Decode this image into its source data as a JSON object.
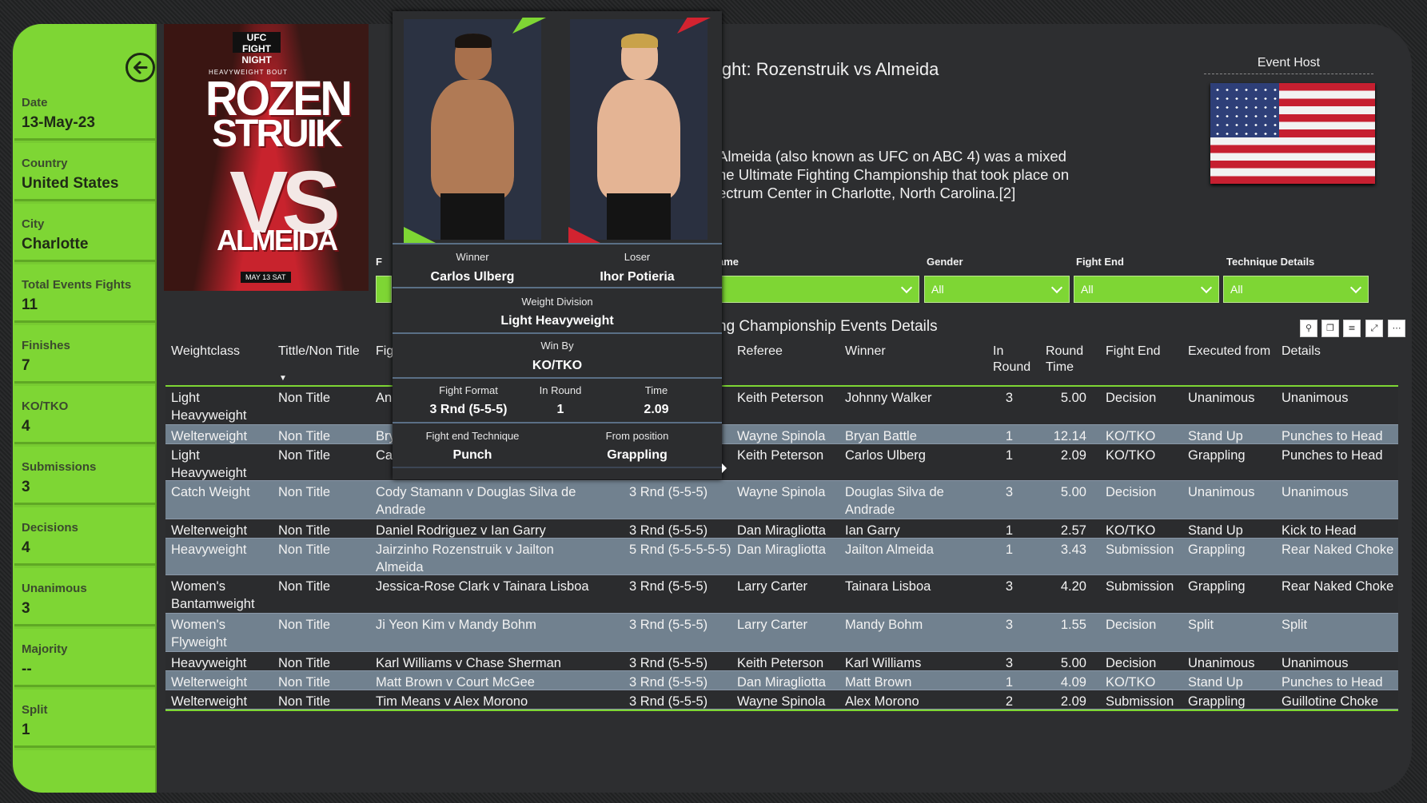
{
  "sidebar": {
    "kpis": [
      {
        "label": "Date",
        "value": "13-May-23"
      },
      {
        "label": "Country",
        "value": "United States"
      },
      {
        "label": "City",
        "value": "Charlotte"
      },
      {
        "label": "Total Events Fights",
        "value": "11"
      },
      {
        "label": "Finishes",
        "value": "7"
      },
      {
        "label": "KO/TKO",
        "value": "4"
      },
      {
        "label": "Submissions",
        "value": "3"
      },
      {
        "label": "Decisions",
        "value": "4"
      },
      {
        "label": "Unanimous",
        "value": "3"
      },
      {
        "label": "Majority",
        "value": "--"
      },
      {
        "label": "Split",
        "value": "1"
      }
    ]
  },
  "poster": {
    "logo": "UFC FIGHT NIGHT",
    "bout": "HEAVYWEIGHT BOUT",
    "name1a": "ROZEN",
    "name1b": "STRUIK",
    "vs": "VS",
    "name2": "ALMEIDA",
    "date": "MAY 13 SAT"
  },
  "header": {
    "title": "ight: Rozenstruik vs Almeida",
    "description": "Almeida (also known as UFC on ABC 4) was a mixed\nhe Ultimate Fighting Championship that took place on\nectrum Center in Charlotte, North Carolina.[2]",
    "host_label": "Event Host"
  },
  "slicers": [
    {
      "label": "F",
      "value": ""
    },
    {
      "label": "ame",
      "value": ""
    },
    {
      "label": "Gender",
      "value": "All"
    },
    {
      "label": "Fight End",
      "value": "All"
    },
    {
      "label": "Technique Details",
      "value": "All"
    }
  ],
  "table": {
    "title": "ng Championship Events Details",
    "columns": [
      "Weightclass",
      "Tittle/Non Title",
      "Fig",
      "",
      "Referee",
      "Winner",
      "In Round",
      "Round Time",
      "Fight End",
      "Executed from",
      "Details"
    ],
    "rows": [
      {
        "wc": "Light\nHeavyweight",
        "tt": "Non Title",
        "fight": "An",
        "fmt": "",
        "ref": "Keith Peterson",
        "win": "Johnny Walker",
        "rnd": "3",
        "time": "5.00",
        "end": "Decision",
        "from": "Unanimous",
        "det": "Unanimous"
      },
      {
        "wc": "Welterweight",
        "tt": "Non Title",
        "fight": "Bry",
        "fmt": "",
        "ref": "Wayne Spinola",
        "win": "Bryan Battle",
        "rnd": "1",
        "time": "12.14",
        "end": "KO/TKO",
        "from": "Stand Up",
        "det": "Punches to Head"
      },
      {
        "wc": "Light\nHeavyweight",
        "tt": "Non Title",
        "fight": "Ca",
        "fmt": "",
        "ref": "Keith Peterson",
        "win": "Carlos Ulberg",
        "rnd": "1",
        "time": "2.09",
        "end": "KO/TKO",
        "from": "Grappling",
        "det": "Punches to Head"
      },
      {
        "wc": "Catch Weight",
        "tt": "Non Title",
        "fight": "Cody Stamann v Douglas Silva de\nAndrade",
        "fmt": "3 Rnd (5-5-5)",
        "ref": "Wayne Spinola",
        "win": "Douglas Silva de\nAndrade",
        "rnd": "3",
        "time": "5.00",
        "end": "Decision",
        "from": "Unanimous",
        "det": "Unanimous"
      },
      {
        "wc": "Welterweight",
        "tt": "Non Title",
        "fight": "Daniel Rodriguez v Ian Garry",
        "fmt": "3 Rnd (5-5-5)",
        "ref": "Dan Miragliotta",
        "win": "Ian Garry",
        "rnd": "1",
        "time": "2.57",
        "end": "KO/TKO",
        "from": "Stand Up",
        "det": "Kick to Head"
      },
      {
        "wc": "Heavyweight",
        "tt": "Non Title",
        "fight": "Jairzinho Rozenstruik v Jailton\nAlmeida",
        "fmt": "5 Rnd (5-5-5-5-5)",
        "ref": "Dan Miragliotta",
        "win": "Jailton Almeida",
        "rnd": "1",
        "time": "3.43",
        "end": "Submission",
        "from": "Grappling",
        "det": "Rear Naked Choke"
      },
      {
        "wc": "Women's\nBantamweight",
        "tt": "Non Title",
        "fight": "Jessica-Rose Clark v Tainara Lisboa",
        "fmt": "3 Rnd (5-5-5)",
        "ref": "Larry Carter",
        "win": "Tainara Lisboa",
        "rnd": "3",
        "time": "4.20",
        "end": "Submission",
        "from": "Grappling",
        "det": "Rear Naked Choke"
      },
      {
        "wc": "Women's\nFlyweight",
        "tt": "Non Title",
        "fight": "Ji Yeon Kim v Mandy Bohm",
        "fmt": "3 Rnd (5-5-5)",
        "ref": "Larry Carter",
        "win": "Mandy Bohm",
        "rnd": "3",
        "time": "1.55",
        "end": "Decision",
        "from": "Split",
        "det": "Split"
      },
      {
        "wc": "Heavyweight",
        "tt": "Non Title",
        "fight": "Karl Williams v Chase Sherman",
        "fmt": "3 Rnd (5-5-5)",
        "ref": "Keith Peterson",
        "win": "Karl Williams",
        "rnd": "3",
        "time": "5.00",
        "end": "Decision",
        "from": "Unanimous",
        "det": "Unanimous"
      },
      {
        "wc": "Welterweight",
        "tt": "Non Title",
        "fight": "Matt Brown v Court McGee",
        "fmt": "3 Rnd (5-5-5)",
        "ref": "Dan Miragliotta",
        "win": "Matt Brown",
        "rnd": "1",
        "time": "4.09",
        "end": "KO/TKO",
        "from": "Stand Up",
        "det": "Punches to Head"
      },
      {
        "wc": "Welterweight",
        "tt": "Non Title",
        "fight": "Tim Means v Alex Morono",
        "fmt": "3 Rnd (5-5-5)",
        "ref": "Wayne Spinola",
        "win": "Alex Morono",
        "rnd": "2",
        "time": "2.09",
        "end": "Submission",
        "from": "Grappling",
        "det": "Guillotine Choke"
      }
    ]
  },
  "tooltip": {
    "winner_label": "Winner",
    "winner": "Carlos Ulberg",
    "loser_label": "Loser",
    "loser": "Ihor Potieria",
    "weight_label": "Weight Division",
    "weight": "Light Heavyweight",
    "winby_label": "Win By",
    "winby": "KO/TKO",
    "format_label": "Fight Format",
    "format": "3 Rnd (5-5-5)",
    "round_label": "In Round",
    "round": "1",
    "time_label": "Time",
    "time": "2.09",
    "tech_label": "Fight end Technique",
    "tech": "Punch",
    "pos_label": "From position",
    "pos": "Grappling"
  },
  "colors": {
    "accent": "#7ed634",
    "red": "#d22330",
    "row_light": "#71818f",
    "row_dark": "#2b2c2e"
  }
}
